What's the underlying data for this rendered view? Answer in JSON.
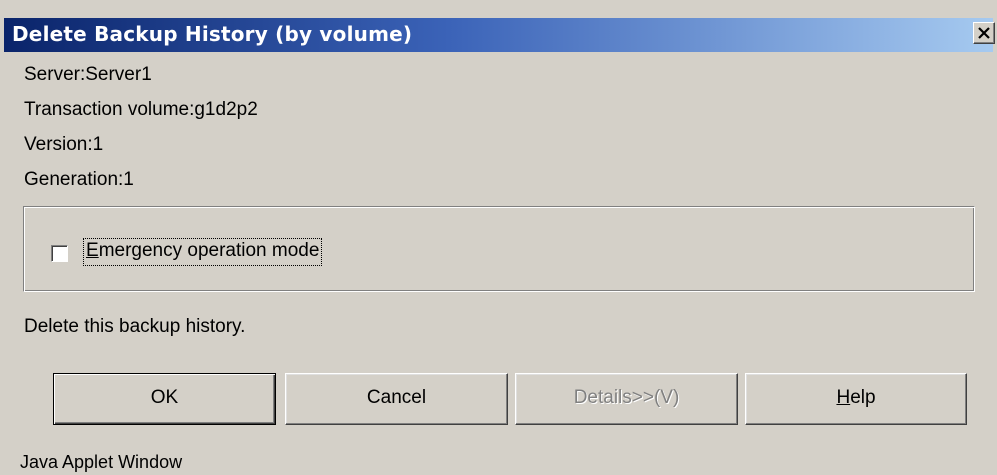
{
  "window": {
    "title": "Delete Backup History (by volume)",
    "close_label": "×"
  },
  "info": {
    "server": "Server:Server1",
    "transaction_volume": "Transaction volume:g1d2p2",
    "version": "Version:1",
    "generation": "Generation:1"
  },
  "options": {
    "emergency_mode": {
      "label_prefix": "",
      "mnemonic": "E",
      "label_rest": "mergency operation mode",
      "checked": false
    }
  },
  "message": "Delete this backup history.",
  "buttons": {
    "ok": "OK",
    "cancel": "Cancel",
    "details": "Details>>(V)",
    "help_mnemonic": "H",
    "help_rest": "elp"
  },
  "footer": "Java Applet Window",
  "colors": {
    "title_gradient_start": "#0a246a",
    "title_gradient_end": "#a6caf0",
    "face": "#d4d0c8",
    "disabled_text": "#808080"
  }
}
